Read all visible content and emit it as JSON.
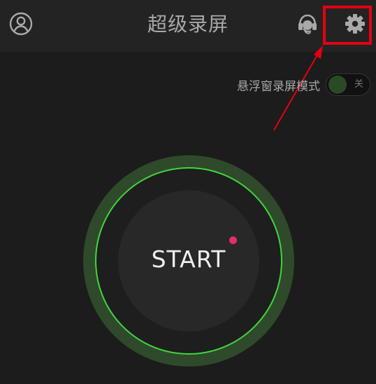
{
  "header": {
    "title": "超级录屏"
  },
  "icons": {
    "profile": "user-circle-icon",
    "support": "headset-icon",
    "settings": "gear-icon"
  },
  "floating_mode": {
    "label": "悬浮窗录屏模式",
    "toggle_state": "关"
  },
  "start_button": {
    "label": "START"
  },
  "colors": {
    "background": "#1c1c1c",
    "header": "#232323",
    "accent_green": "#3ed73e",
    "ring_green": "#2f4a2a",
    "record_dot": "#e0306a",
    "highlight": "#e60012"
  }
}
